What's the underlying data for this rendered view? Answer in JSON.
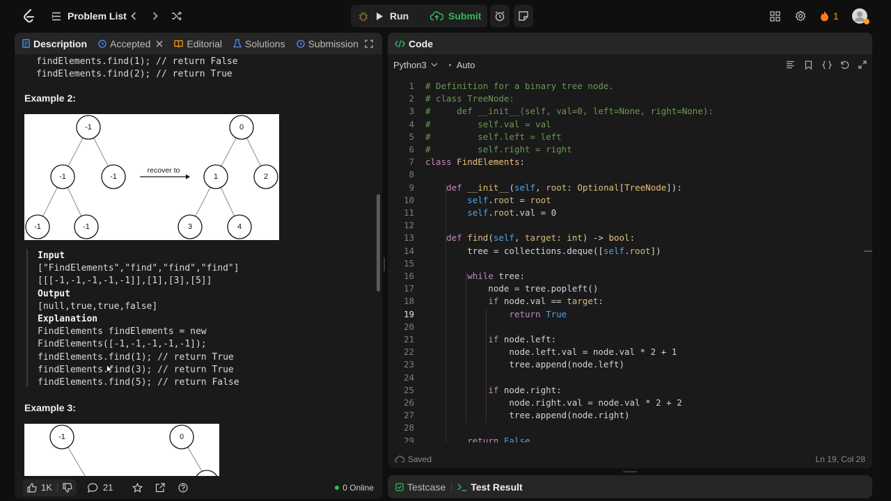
{
  "topbar": {
    "problem_list": "Problem List",
    "run": "Run",
    "submit": "Submit",
    "streak": "1"
  },
  "left_tabs": {
    "description": "Description",
    "accepted": "Accepted",
    "editorial": "Editorial",
    "solutions": "Solutions",
    "submission": "Submission"
  },
  "description": {
    "top_lines": [
      "findElements.find(1); // return False",
      "findElements.find(2); // return True"
    ],
    "example2_title": "Example 2:",
    "example2_tree_left": [
      "-1",
      "-1",
      "-1",
      "-1",
      "-1"
    ],
    "example2_arrow_label": "recover to",
    "example2_tree_right": [
      "0",
      "1",
      "2",
      "3",
      "4"
    ],
    "example2_block": {
      "input_label": "Input",
      "input_lines": [
        "[\"FindElements\",\"find\",\"find\",\"find\"]",
        "[[[-1,-1,-1,-1,-1]],[1],[3],[5]]"
      ],
      "output_label": "Output",
      "output_line": "[null,true,true,false]",
      "explanation_label": "Explanation",
      "explanation_lines": [
        "FindElements findElements = new",
        "FindElements([-1,-1,-1,-1,-1]);",
        "findElements.find(1); // return True",
        "findElements.find(3); // return True",
        "findElements.find(5); // return False"
      ]
    },
    "example3_title": "Example 3:",
    "example3_nodes": [
      "-1",
      "0"
    ]
  },
  "left_footer": {
    "likes": "1K",
    "comments": "21",
    "online": "0 Online"
  },
  "code_panel": {
    "title": "Code",
    "language": "Python3",
    "mode": "Auto",
    "saved": "Saved",
    "cursor": "Ln 19, Col 28",
    "current_line": 19
  },
  "code_lines": [
    "# Definition for a binary tree node.",
    "# class TreeNode:",
    "#     def __init__(self, val=0, left=None, right=None):",
    "#         self.val = val",
    "#         self.left = left",
    "#         self.right = right",
    "class FindElements:",
    "",
    "    def __init__(self, root: Optional[TreeNode]):",
    "        self.root = root",
    "        self.root.val = 0",
    "",
    "    def find(self, target: int) -> bool:",
    "        tree = collections.deque([self.root])",
    "",
    "        while tree:",
    "            node = tree.popleft()",
    "            if node.val == target:",
    "                return True",
    "",
    "            if node.left:",
    "                node.left.val = node.val * 2 + 1",
    "                tree.append(node.left)",
    "",
    "            if node.right:",
    "                node.right.val = node.val * 2 + 2",
    "                tree.append(node.right)",
    "",
    "        return False"
  ],
  "bottom_tabs": {
    "testcase": "Testcase",
    "test_result": "Test Result"
  },
  "colors": {
    "submit_green": "#2cbb5d",
    "accent_orange": "#ffa116",
    "online_green": "#2cbb5d"
  }
}
